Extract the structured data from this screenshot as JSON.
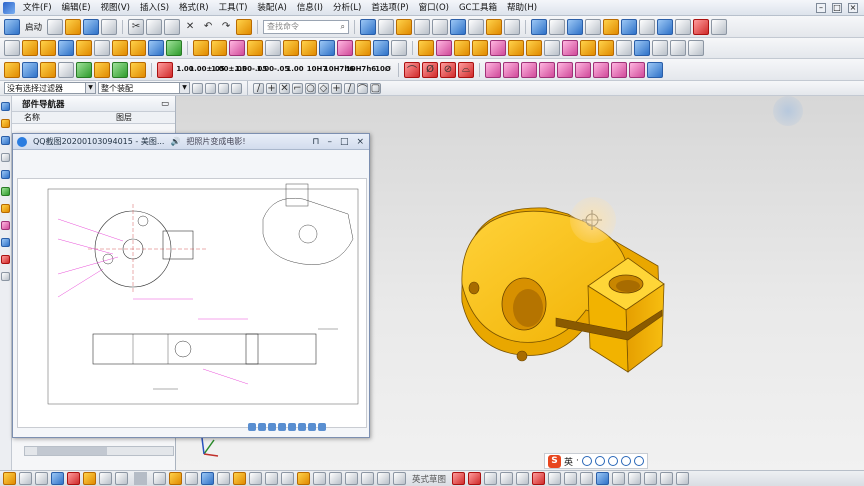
{
  "menubar": {
    "items": [
      "文件(F)",
      "编辑(E)",
      "视图(V)",
      "插入(S)",
      "格式(R)",
      "工具(T)",
      "装配(A)",
      "信息(I)",
      "分析(L)",
      "首选项(P)",
      "窗口(O)",
      "GC工具箱",
      "帮助(H)"
    ]
  },
  "toolbar": {
    "start_label": "启动",
    "search_placeholder": "查找命令",
    "dims": [
      {
        "top": "1.00",
        "bot": ""
      },
      {
        "top": "1.00",
        "bot": "±.05"
      },
      {
        "top": "1.00",
        "bot": "±.05"
      },
      {
        "top": "1.00",
        "bot": "-.05"
      },
      {
        "top": "1.00",
        "bot": "-.05"
      },
      {
        "top": "1.00",
        "bot": ""
      },
      {
        "top": "10H7",
        "bot": ""
      },
      {
        "top": "10H7",
        "bot": "h6"
      },
      {
        "top": "10H7",
        "bot": "h6"
      },
      {
        "top": "10",
        "bot": "Ø"
      }
    ],
    "filter_label": "没有选择过滤器",
    "assembly_label": "整个装配"
  },
  "navigator": {
    "title": "部件导航器",
    "col_name": "名称",
    "col_graphic": "图层"
  },
  "viewer": {
    "title": "QQ截图20200103094015 - 美图...",
    "subtitle": "把照片变成电影!",
    "accent": "#2b7de0"
  },
  "ime": {
    "lang": "英",
    "brand": "S"
  },
  "bottom": {
    "label": "英式草图"
  },
  "colors": {
    "model": "#f0b400",
    "model_dark": "#c98600",
    "highlight": "#e94bd8"
  }
}
